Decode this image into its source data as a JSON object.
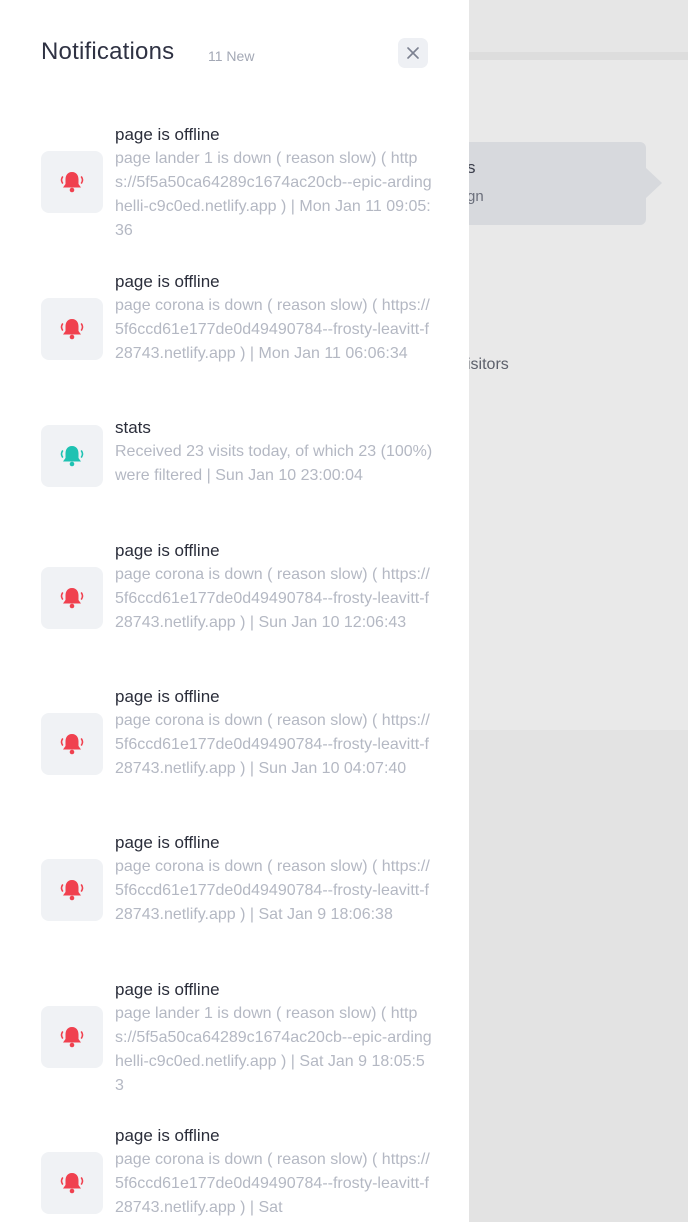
{
  "background": {
    "tooltip_title": "s",
    "tooltip_subtitle": "gn",
    "visitors_label": "isitors"
  },
  "header": {
    "title": "Notifications",
    "new_count": "11 New"
  },
  "colors": {
    "alert": "#f0414f",
    "info": "#1ec2b2"
  },
  "notifications": [
    {
      "title": "page is offline",
      "text": "page lander 1 is down ( reason slow) ( https://5f5a50ca64289c1674ac20cb--epic-ardinghelli-c9c0ed.netlify.app ) | Mon Jan 11 09:05:36",
      "icon": "bell-alert-icon"
    },
    {
      "title": "page is offline",
      "text": "page corona is down ( reason slow) ( https://5f6ccd61e177de0d49490784--frosty-leavitt-f28743.netlify.app ) | Mon Jan 11 06:06:34",
      "icon": "bell-alert-icon"
    },
    {
      "title": "stats",
      "text": "Received 23 visits today, of which 23 (100%) were filtered | Sun Jan 10 23:00:04",
      "icon": "bell-info-icon"
    },
    {
      "title": "page is offline",
      "text": "page corona is down ( reason slow) ( https://5f6ccd61e177de0d49490784--frosty-leavitt-f28743.netlify.app ) | Sun Jan 10 12:06:43",
      "icon": "bell-alert-icon"
    },
    {
      "title": "page is offline",
      "text": "page corona is down ( reason slow) ( https://5f6ccd61e177de0d49490784--frosty-leavitt-f28743.netlify.app ) | Sun Jan 10 04:07:40",
      "icon": "bell-alert-icon"
    },
    {
      "title": "page is offline",
      "text": "page corona is down ( reason slow) ( https://5f6ccd61e177de0d49490784--frosty-leavitt-f28743.netlify.app ) | Sat Jan 9 18:06:38",
      "icon": "bell-alert-icon"
    },
    {
      "title": "page is offline",
      "text": "page lander 1 is down ( reason slow) ( https://5f5a50ca64289c1674ac20cb--epic-ardinghelli-c9c0ed.netlify.app ) | Sat Jan 9 18:05:53",
      "icon": "bell-alert-icon"
    },
    {
      "title": "page is offline",
      "text": "page corona is down ( reason slow) ( https://5f6ccd61e177de0d49490784--frosty-leavitt-f28743.netlify.app ) | Sat",
      "icon": "bell-alert-icon"
    }
  ]
}
